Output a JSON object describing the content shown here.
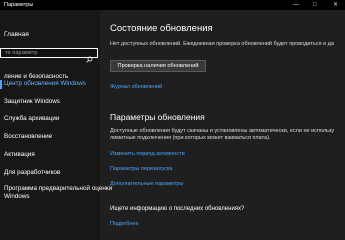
{
  "window": {
    "title": "Параметры",
    "controls": {
      "minimize": "—",
      "maximize": "□",
      "close": "✕"
    }
  },
  "sidebar": {
    "home": "Главная",
    "search_placeholder": "те параметр",
    "section": "ление и безопасность",
    "items": [
      {
        "label": "Центр обновления Windows",
        "active": true
      },
      {
        "label": "Защитник Windows"
      },
      {
        "label": "Служба архивации"
      },
      {
        "label": "Восстановление"
      },
      {
        "label": "Активация"
      },
      {
        "label": "Для разработчиков"
      },
      {
        "label": "Программа предварительной оценки",
        "line2": "Windows"
      }
    ]
  },
  "main": {
    "status_title": "Состояние обновления",
    "status_text": "Нет доступных обновлений. Ежедневная проверка обновлений будет проводиться и да",
    "check_button": "Проверка наличия обновлений",
    "history_link": "Журнал обновлений",
    "settings_title": "Параметры обновления",
    "settings_text_1": "Доступные обновления будут скачаны и установлены автоматически, если не использу",
    "settings_text_2": "лимитные подключения (при которых может взиматься плата).",
    "links": [
      "Изменить период активности",
      "Параметры перезапуска",
      "Дополнительные параметры"
    ],
    "info_title": "Ищете информацию о последних обновлениях?",
    "more_link": "Подробнее"
  }
}
